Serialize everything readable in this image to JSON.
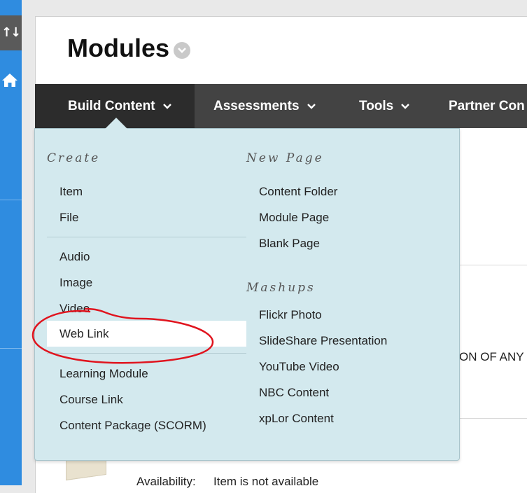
{
  "page": {
    "title": "Modules"
  },
  "toolbar": {
    "items": [
      {
        "label": "Build Content"
      },
      {
        "label": "Assessments"
      },
      {
        "label": "Tools"
      },
      {
        "label": "Partner Con"
      }
    ]
  },
  "dropdown": {
    "create": {
      "heading": "Create",
      "items": [
        "Item",
        "File",
        "Audio",
        "Image",
        "Video",
        "Web Link",
        "Learning Module",
        "Course Link",
        "Content Package (SCORM)"
      ]
    },
    "new_page": {
      "heading": "New Page",
      "items": [
        "Content Folder",
        "Module Page",
        "Blank Page"
      ]
    },
    "mashups": {
      "heading": "Mashups",
      "items": [
        "Flickr Photo",
        "SlideShare Presentation",
        "YouTube Video",
        "NBC Content",
        "xpLor Content"
      ]
    }
  },
  "background": {
    "text_fragment": "ON OF ANY",
    "availability_label": "Availability:",
    "availability_value": "Item is not available"
  },
  "colors": {
    "rail_blue": "#2f8ce0",
    "toolbar": "#434343",
    "dropdown_bg": "#d3e9ee",
    "annotation_red": "#e0141e"
  },
  "icons": [
    "sort-icon",
    "home-icon",
    "chevron-down-icon"
  ]
}
